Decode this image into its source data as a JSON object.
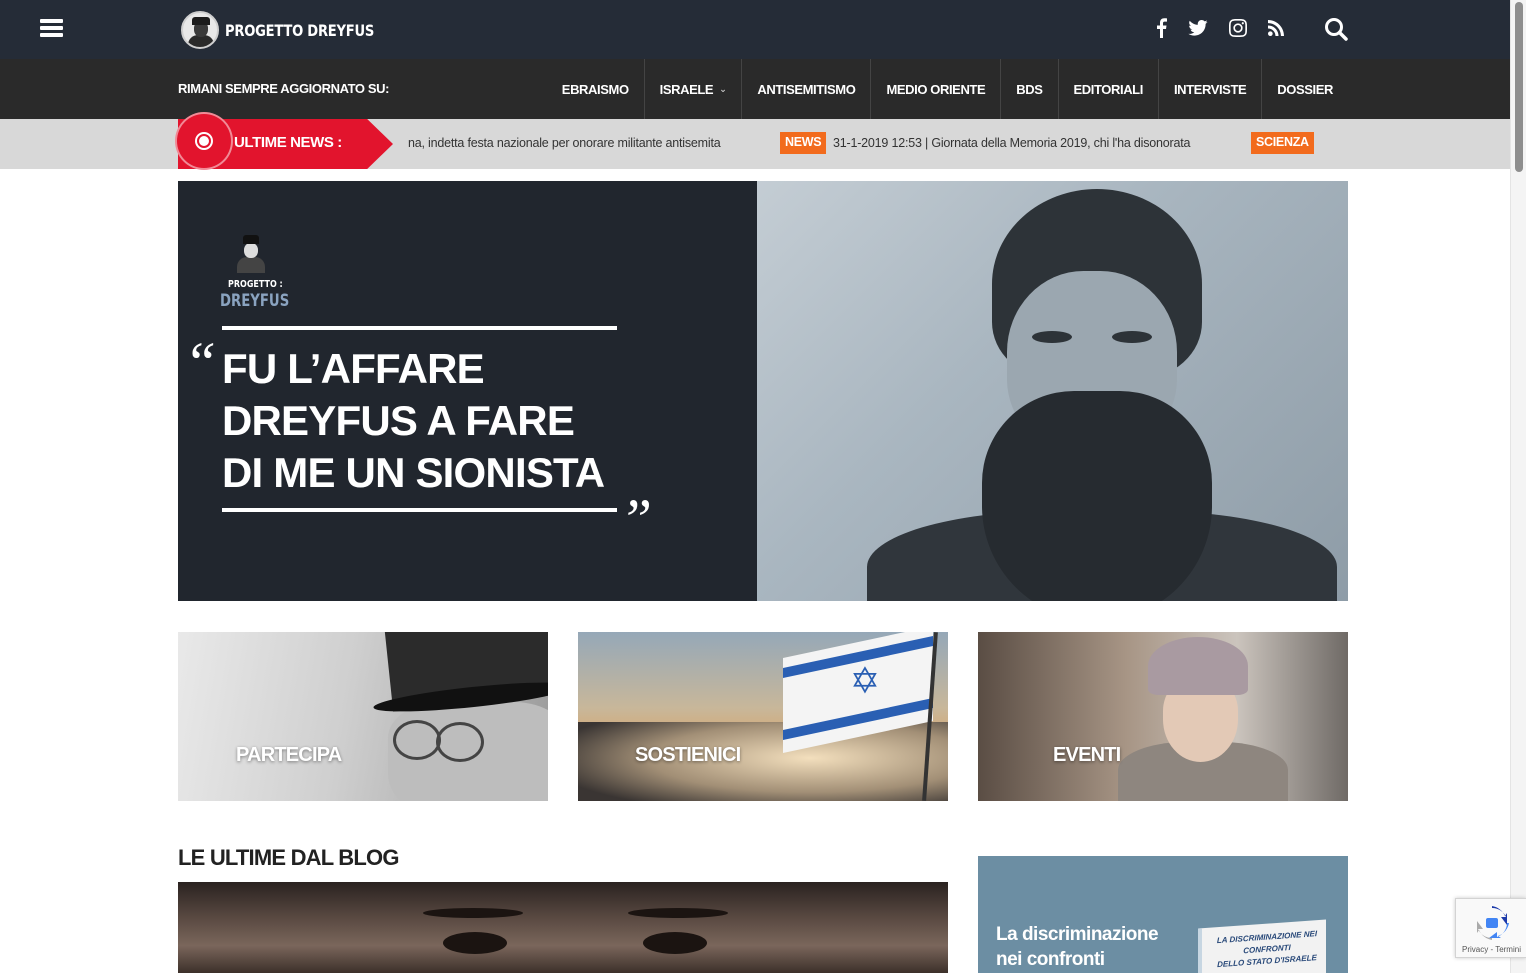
{
  "header": {
    "logo_text": "PROGETTO DREYFUS",
    "icons": [
      "menu-icon",
      "facebook-icon",
      "twitter-icon",
      "instagram-icon",
      "rss-icon",
      "search-icon"
    ]
  },
  "nav": {
    "left_text": "RIMANI SEMPRE AGGIORNATO SU:",
    "items": [
      {
        "label": "EBRAISMO"
      },
      {
        "label": "ISRAELE",
        "caret": "⌄"
      },
      {
        "label": "ANTISEMITISMO"
      },
      {
        "label": "MEDIO ORIENTE"
      },
      {
        "label": "BDS"
      },
      {
        "label": "EDITORIALI"
      },
      {
        "label": "INTERVISTE"
      },
      {
        "label": "DOSSIER"
      }
    ]
  },
  "ticker": {
    "label": "ULTIME NEWS :",
    "item_1_text": "na, indetta festa nazionale per onorare militante antisemita",
    "item_2_tag": "NEWS",
    "item_2_text": "31-1-2019 12:53 | Giornata della Memoria 2019, chi l'ha disonorata",
    "item_3_tag": "SCIENZA"
  },
  "hero": {
    "logo_line1": "PROGETTO :",
    "logo_line2": "DREYFUS",
    "quote_open": "“",
    "quote_close": "„",
    "quote_line1": "FU L’AFFARE",
    "quote_line2": "DREYFUS A FARE",
    "quote_line3": "DI ME UN SIONISTA"
  },
  "cards": [
    {
      "label": "PARTECIPA"
    },
    {
      "label": "SOSTIENICI"
    },
    {
      "label": "EVENTI"
    }
  ],
  "blog": {
    "title": "LE ULTIME DAL BLOG"
  },
  "promo": {
    "line1": "La discriminazione",
    "line2": "nei confronti",
    "book_line1": "LA DISCRIMINAZIONE NEI CONFRONTI",
    "book_line2": "DELLO STATO D'ISRAELE"
  },
  "recaptcha": {
    "text": "Privacy - Termini"
  },
  "colors": {
    "header_bg": "#252c37",
    "nav_bg": "#2a2a2a",
    "ticker_red": "#e2142d",
    "tag_orange": "#f26b1d",
    "hero_bg": "#21262e"
  }
}
